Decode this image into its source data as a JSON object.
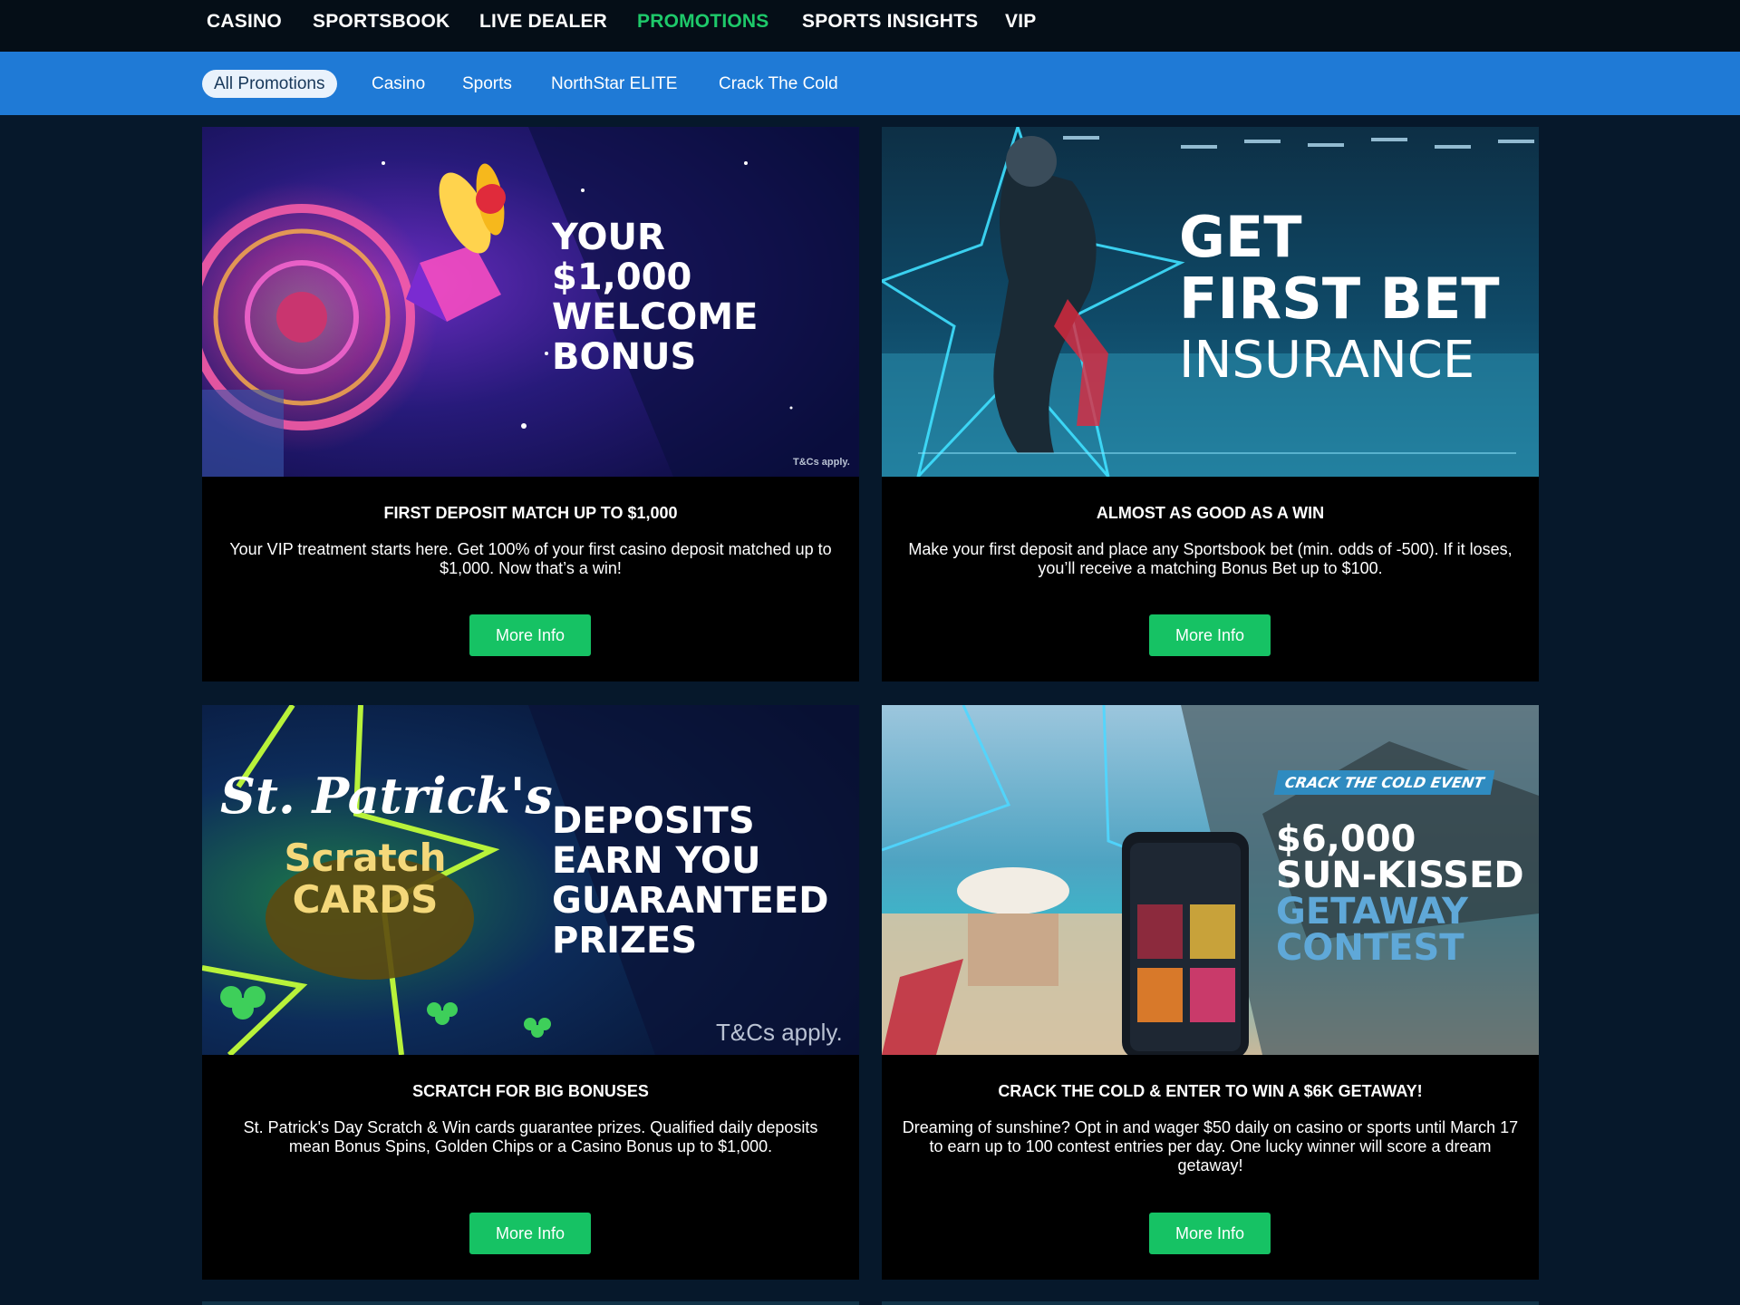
{
  "top_nav": {
    "items": [
      {
        "label": "CASINO",
        "active": false
      },
      {
        "label": "SPORTSBOOK",
        "active": false
      },
      {
        "label": "LIVE DEALER",
        "active": false
      },
      {
        "label": "PROMOTIONS",
        "active": true
      },
      {
        "label": "SPORTS INSIGHTS",
        "active": false
      },
      {
        "label": "VIP",
        "active": false
      }
    ],
    "active_color": "#1ec96a"
  },
  "sub_nav": {
    "items": [
      {
        "label": "All Promotions",
        "active": true
      },
      {
        "label": "Casino",
        "active": false
      },
      {
        "label": "Sports",
        "active": false
      },
      {
        "label": "NorthStar ELITE",
        "active": false
      },
      {
        "label": "Crack The Cold",
        "active": false
      }
    ],
    "bar_color": "#1f7ad6"
  },
  "promotions": [
    {
      "banner": {
        "headline_lines": [
          "YOUR",
          "$1,000",
          "WELCOME",
          "BONUS"
        ],
        "tcs": "T&Cs apply."
      },
      "title": "FIRST DEPOSIT MATCH UP TO $1,000",
      "description": "Your VIP treatment starts here. Get 100% of your first casino deposit matched up to $1,000. Now that’s a win!",
      "button": "More Info"
    },
    {
      "banner": {
        "headline_lines": [
          "GET",
          "FIRST BET",
          "INSURANCE"
        ]
      },
      "title": "ALMOST AS GOOD AS A WIN",
      "description": "Make your first deposit and place any Sportsbook bet (min. odds of -500). If it loses, you’ll receive a matching Bonus Bet up to $100.",
      "button": "More Info"
    },
    {
      "banner": {
        "logo_lines": [
          "St. Patrick's",
          "Scratch",
          "CARDS"
        ],
        "headline_lines": [
          "DEPOSITS",
          "EARN YOU",
          "GUARANTEED",
          "PRIZES"
        ],
        "tcs": "T&Cs apply."
      },
      "title": "SCRATCH FOR BIG BONUSES",
      "description": "St. Patrick's Day Scratch & Win cards guarantee prizes. Qualified daily deposits mean Bonus Spins, Golden Chips or a Casino Bonus up to $1,000.",
      "button": "More Info"
    },
    {
      "banner": {
        "tag": "CRACK THE COLD EVENT",
        "headline_lines": [
          "$6,000",
          "SUN-KISSED",
          "GETAWAY",
          "CONTEST"
        ]
      },
      "title": "CRACK THE COLD & ENTER TO WIN A $6K GETAWAY!",
      "description": "Dreaming of sunshine? Opt in and wager $50 daily on casino or sports until March 17 to earn up to 100 contest entries per day. One lucky winner will score a dream getaway!",
      "button": "More Info"
    }
  ],
  "colors": {
    "page_bg": "#06182b",
    "button_green": "#16c264",
    "card_bg": "#000000",
    "contest_accent": "#5fa8d8"
  }
}
